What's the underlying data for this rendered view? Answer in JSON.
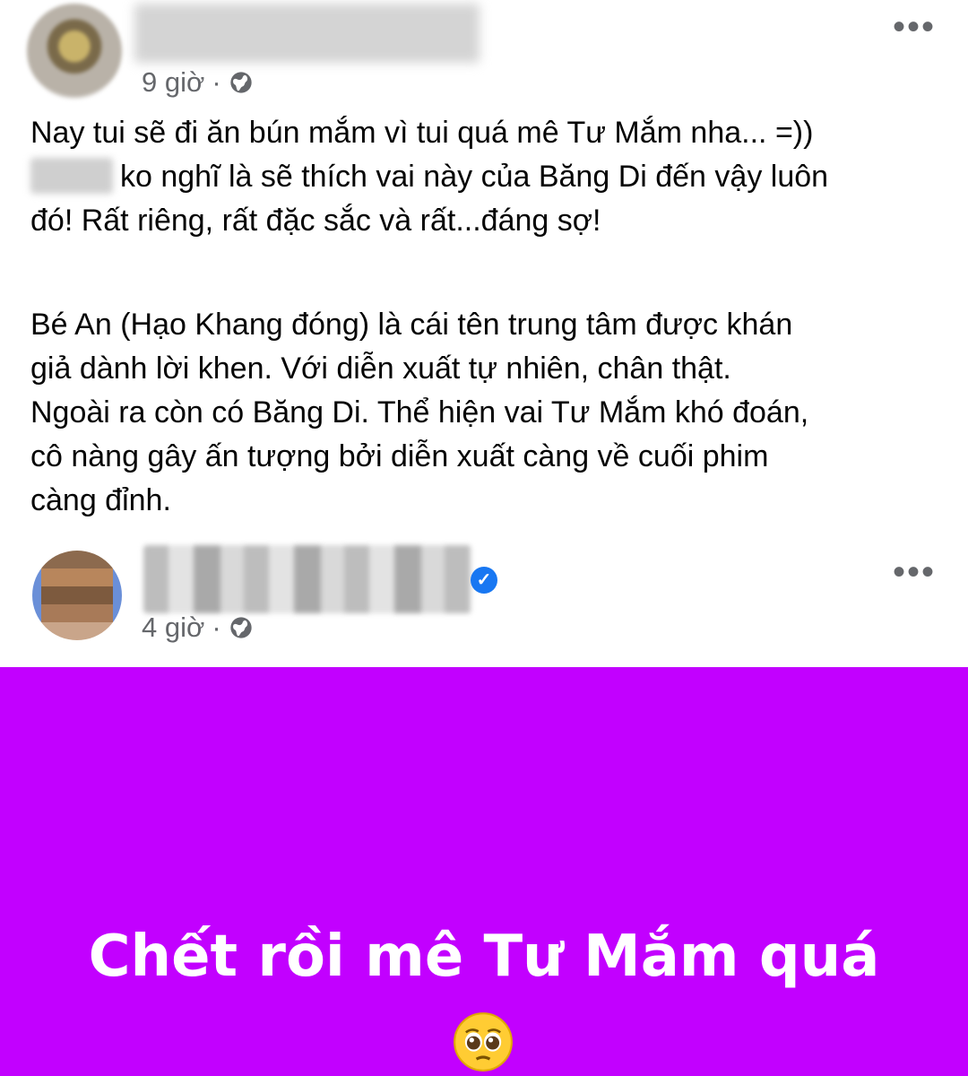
{
  "post1": {
    "author_name": "",
    "time": "9 giờ",
    "separator": "·",
    "line1": "Nay tui sẽ đi ăn bún mắm vì tui quá mê Tư Mắm nha... =))",
    "line2_tail": "ko nghĩ là sẽ thích vai này của Băng Di đến vậy luôn",
    "line3": "đó! Rất riêng, rất đặc sắc và rất...đáng sợ!",
    "para2_l1": "Bé An (Hạo Khang đóng) là cái tên trung tâm được khán",
    "para2_l2": "giả dành lời khen. Với diễn xuất tự nhiên, chân thật.",
    "para2_l3": "Ngoài ra còn có Băng Di. Thể hiện vai Tư Mắm khó đoán,",
    "para2_l4": "cô nàng gây ấn tượng bởi diễn xuất càng về cuối phim",
    "para2_l5": "càng đỉnh.",
    "more_label": "•••"
  },
  "post2": {
    "author_name": "",
    "time": "4 giờ",
    "separator": "·",
    "verified_mark": "✓",
    "more_label": "•••",
    "story_text": "Chết rồi mê Tư Mắm quá",
    "story_bg_color": "#c200ff"
  }
}
